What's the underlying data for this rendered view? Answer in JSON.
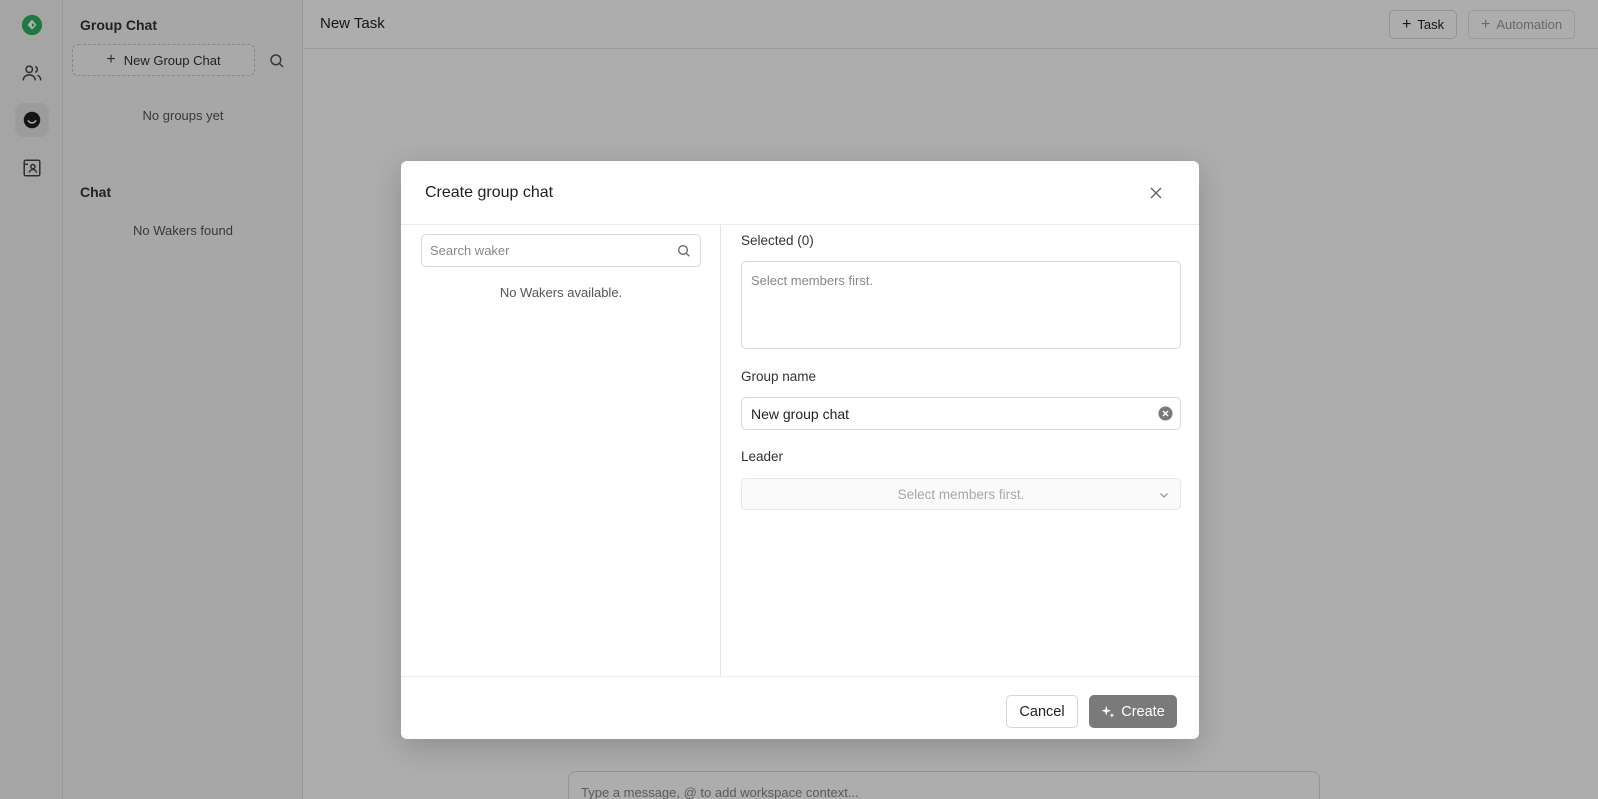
{
  "colors": {
    "overlay": "#000000",
    "brand": "#2fb160",
    "primary_disabled": "#7a7a7a"
  },
  "rail": {
    "items": [
      {
        "icon": "app-logo-icon"
      },
      {
        "icon": "users-icon"
      },
      {
        "icon": "chat-icon",
        "active": true
      },
      {
        "icon": "contacts-folder-icon"
      }
    ]
  },
  "panel": {
    "group_chat_title": "Group Chat",
    "new_group_label": "New Group Chat",
    "no_groups": "No groups yet",
    "chat_title": "Chat",
    "no_wakers": "No Wakers found"
  },
  "main": {
    "title": "New Task",
    "task_label": "Task",
    "automation_label": "Automation",
    "composer_placeholder": "Type a message, @ to add workspace context..."
  },
  "modal": {
    "title": "Create group chat",
    "search_placeholder": "Search waker",
    "no_wakers_available": "No Wakers available.",
    "selected_label": "Selected (0)",
    "selected_placeholder": "Select members first.",
    "group_name_label": "Group name",
    "group_name_value": "New group chat",
    "leader_label": "Leader",
    "leader_placeholder": "Select members first.",
    "cancel_label": "Cancel",
    "create_label": "Create"
  }
}
